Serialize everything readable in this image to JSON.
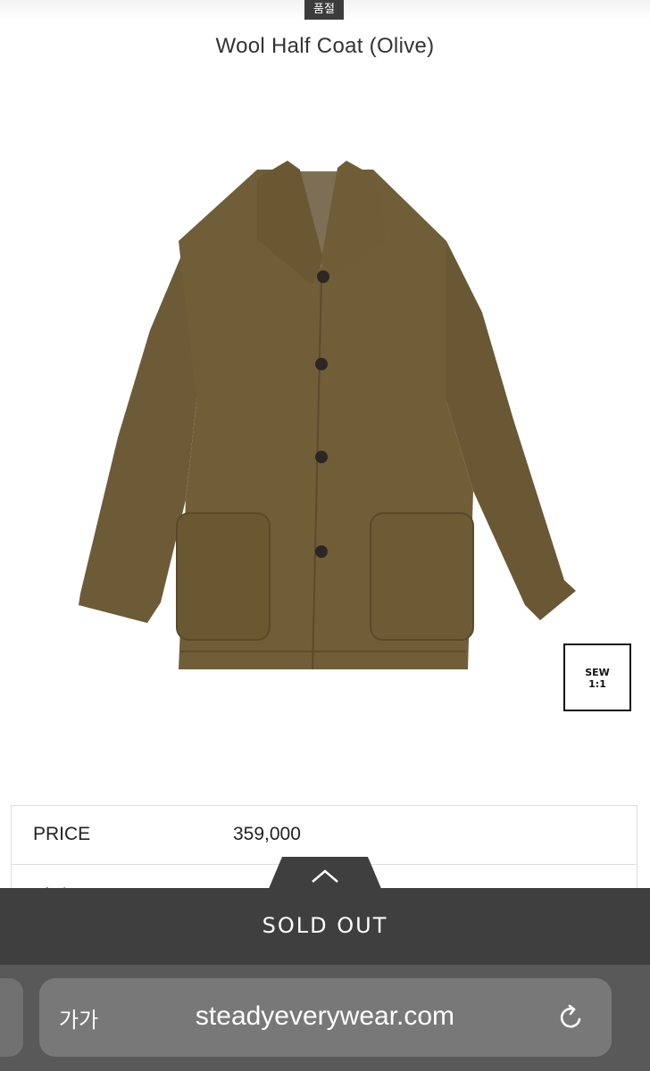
{
  "status_badge": "품절",
  "product": {
    "title": "Wool Half Coat (Olive)",
    "image_icon": "coat-image",
    "sew_badge_line1": "SEW",
    "sew_badge_line2": "1:1"
  },
  "info_table": {
    "rows": [
      {
        "label": "PRICE",
        "value": "359,000"
      },
      {
        "label": "적립금",
        "value": ""
      }
    ]
  },
  "drawer_toggle_icon": "chevron-up-icon",
  "sold_out_label": "SOLD OUT",
  "browser": {
    "text_size_label": "가가",
    "url": "steadyeverywear.com",
    "reload_icon": "reload-icon"
  },
  "colors": {
    "coat": "#6b5a36",
    "bar_dark": "#3f3f3f",
    "browser_bg": "#595959"
  }
}
